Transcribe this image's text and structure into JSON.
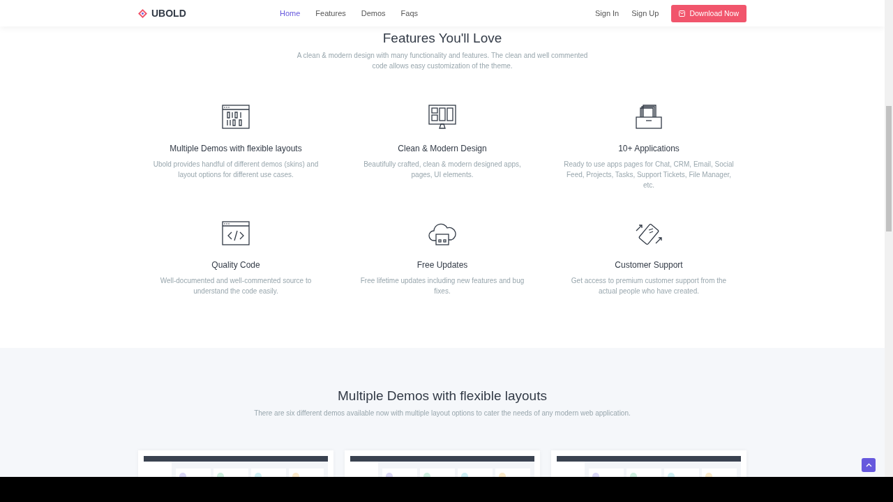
{
  "navbar": {
    "brand": "UBOLD",
    "links": [
      {
        "label": "Home",
        "selected": true
      },
      {
        "label": "Features",
        "selected": false
      },
      {
        "label": "Demos",
        "selected": false
      },
      {
        "label": "Faqs",
        "selected": false
      }
    ],
    "auth": [
      "Sign In",
      "Sign Up"
    ],
    "cta": "Download Now"
  },
  "features_section": {
    "title": "Features You'll Love",
    "subtitle": "A clean & modern design with many functionality and features. The clean and well commented code allows easy customization of the theme.",
    "features": [
      {
        "kind": "binary",
        "title": "Multiple Demos with flexible layouts",
        "text": "Ubold provides handful of different demos (skins) and layout options for different use cases."
      },
      {
        "kind": "monitor",
        "title": "Clean & Modern Design",
        "text": "Beautifully crafted, clean & modern designed apps, pages, UI elements."
      },
      {
        "kind": "inbox",
        "title": "10+ Applications",
        "text": "Ready to use apps pages for Chat, CRM, Email, Social Feed, Projects, Tasks, Support Tickets, File Manager, etc."
      },
      {
        "kind": "code",
        "title": "Quality Code",
        "text": "Well-documented and well-commented source to understand the code easily."
      },
      {
        "kind": "cloud",
        "title": "Free Updates",
        "text": "Free lifetime updates including new features and bug fixes."
      },
      {
        "kind": "phone",
        "title": "Customer Support",
        "text": "Get access to premium customer support from the actual people who have created."
      }
    ]
  },
  "demos_section": {
    "title": "Multiple Demos with flexible layouts",
    "subtitle": "There are six different demos available now with multiple layout options to cater the needs of any modern web application."
  }
}
